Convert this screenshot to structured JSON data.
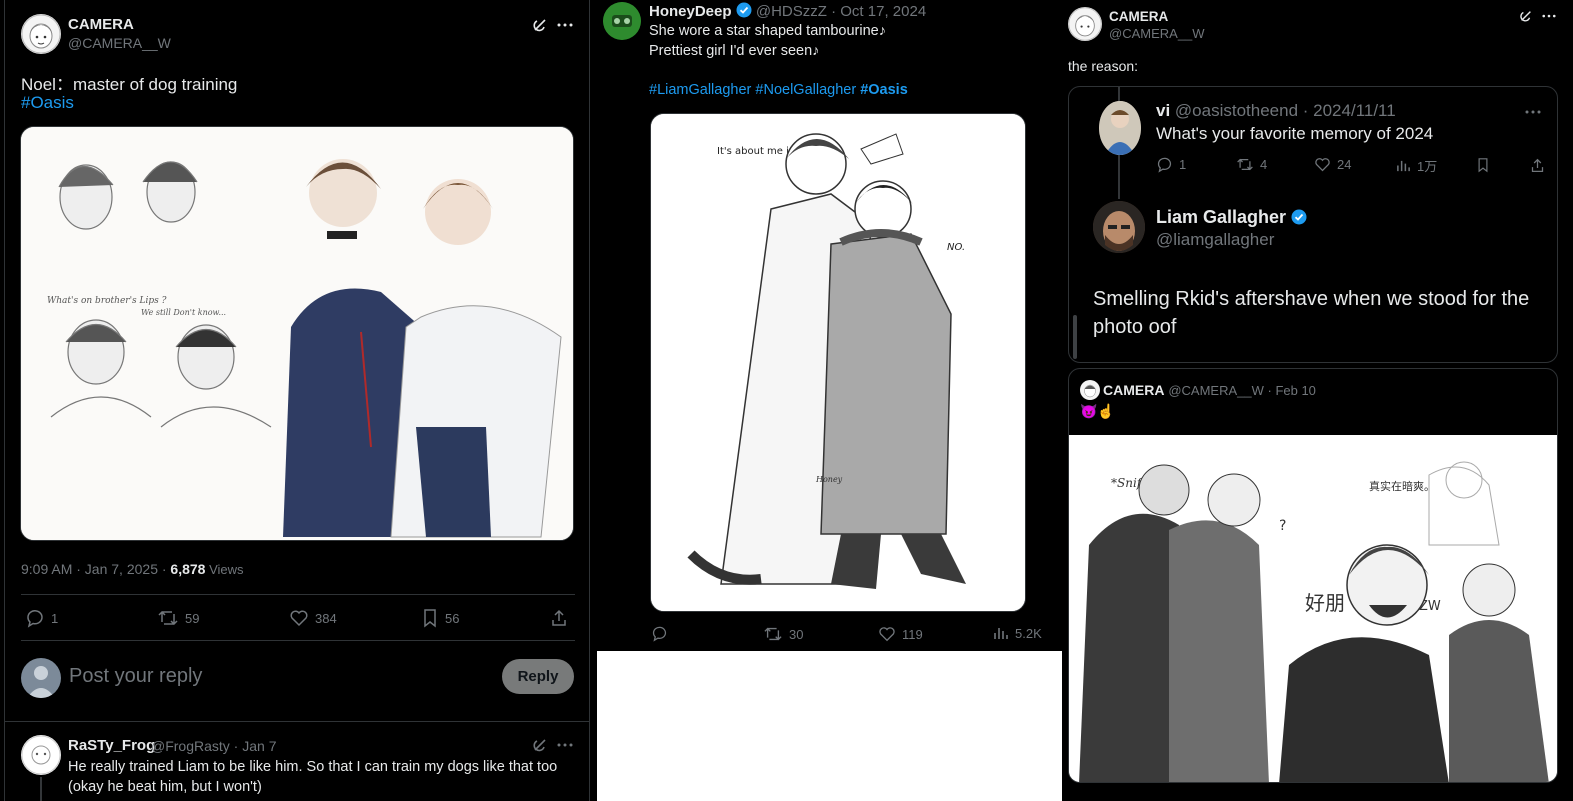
{
  "colors": {
    "accent": "#1d9bf0",
    "muted": "#71767b",
    "border": "#2f3336",
    "bg": "#000000"
  },
  "left": {
    "author_name": "CAMERA",
    "author_handle": "@CAMERA__W",
    "text": "Noel：master of dog training",
    "hashtag": "#Oasis",
    "timestamp": "9:09 AM · Jan 7, 2025 · ",
    "views_count": "6,878",
    "views_label": " Views",
    "stats": {
      "replies": "1",
      "reposts": "59",
      "likes": "384",
      "bookmarks": "56"
    },
    "reply_placeholder": "Post your reply",
    "reply_button": "Reply",
    "art_captions": {
      "line1": "What's on brother's Lips ?",
      "line2": "We still Don't know..."
    },
    "reply": {
      "name": "RaSTy_Frog",
      "handle_date": "@FrogRasty · Jan 7",
      "text": "He really trained Liam to be like him. So that I can train my dogs like that too (okay he beat him, but I won't)"
    }
  },
  "middle": {
    "author_name": "HoneyDeep",
    "handle_date": "@HDSzzZ · Oct 17, 2024",
    "line1": "She wore a star shaped tambourine♪",
    "line2": "Prettiest girl I'd ever seen♪",
    "hashtags": [
      "#LiamGallagher",
      "#NoelGallagher",
      "#Oasis"
    ],
    "art_texts": {
      "speech": "It's about me innit?",
      "no": "NO.",
      "signature": "Honey"
    },
    "stats": {
      "reposts": "30",
      "likes": "119",
      "views": "5.2K"
    }
  },
  "right": {
    "author_name": "CAMERA",
    "author_handle": "@CAMERA__W",
    "text": "the reason:",
    "quote": {
      "name": "vi",
      "handle_date": "@oasistotheend · 2024/11/11",
      "text": "What's your favorite memory of 2024",
      "stats": {
        "replies": "1",
        "reposts": "4",
        "likes": "24",
        "views": "1万"
      },
      "reply_name": "Liam Gallagher",
      "reply_handle": "@liamgallagher",
      "reply_text": "Smelling Rkid's aftershave when we stood for the photo oof"
    },
    "embed": {
      "name": "CAMERA",
      "handle_date": "@CAMERA__W · Feb 10",
      "emoji": "😈☝",
      "art_texts": {
        "sniff": "*Sniff*",
        "hanzi1": "好朋",
        "q": "?",
        "zw": "ZW",
        "cn_note": "真实在暗爽。"
      }
    }
  }
}
